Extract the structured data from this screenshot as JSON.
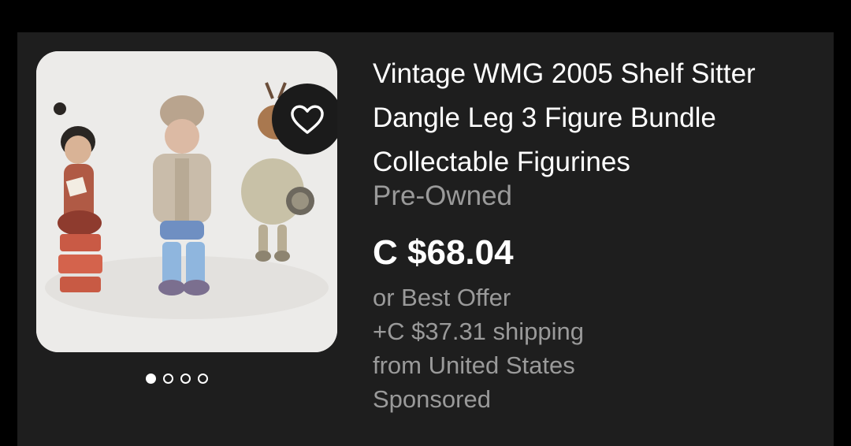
{
  "listing": {
    "title": "Vintage WMG 2005 Shelf Sitter Dangle Leg 3 Figure Bundle Collectable Figurines",
    "condition": "Pre-Owned",
    "price": "C $68.04",
    "offer": "or Best Offer",
    "shipping": "+C $37.31 shipping",
    "location": "from United States",
    "sponsored": "Sponsored"
  },
  "image": {
    "subject": "three shelf sitter figurines",
    "favorite_icon": "heart-outline-icon"
  },
  "carousel": {
    "total": 4,
    "active": 1
  },
  "colors": {
    "background": "#000000",
    "card": "#1e1e1e",
    "title": "#ffffff",
    "secondary_text": "#9a9a9a",
    "image_bg": "#ecebe9"
  }
}
